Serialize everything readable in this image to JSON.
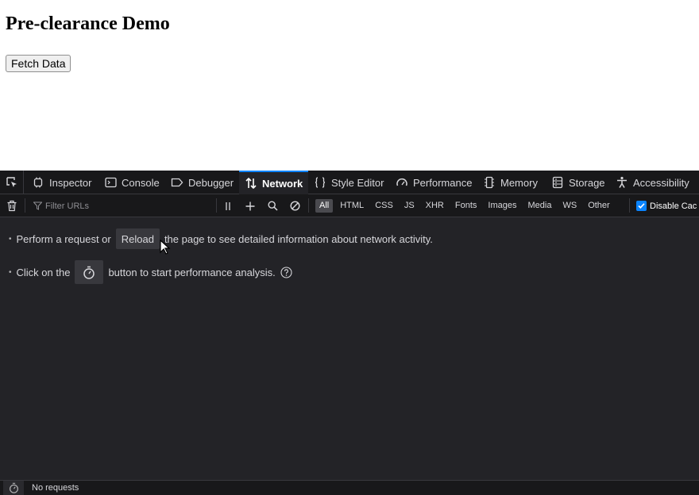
{
  "page": {
    "title": "Pre-clearance Demo",
    "fetch_button": "Fetch Data"
  },
  "devtools": {
    "tabs": [
      {
        "label": "Inspector",
        "icon": "inspector-icon"
      },
      {
        "label": "Console",
        "icon": "console-icon"
      },
      {
        "label": "Debugger",
        "icon": "debugger-icon"
      },
      {
        "label": "Network",
        "icon": "network-icon",
        "active": true
      },
      {
        "label": "Style Editor",
        "icon": "style-editor-icon"
      },
      {
        "label": "Performance",
        "icon": "performance-icon"
      },
      {
        "label": "Memory",
        "icon": "memory-icon"
      },
      {
        "label": "Storage",
        "icon": "storage-icon"
      },
      {
        "label": "Accessibility",
        "icon": "accessibility-icon"
      }
    ],
    "toolbar": {
      "filter_placeholder": "Filter URLs",
      "type_filters": [
        "All",
        "HTML",
        "CSS",
        "JS",
        "XHR",
        "Fonts",
        "Images",
        "Media",
        "WS",
        "Other"
      ],
      "active_filter": "All",
      "disable_cache_label": "Disable Cac",
      "disable_cache_checked": true
    },
    "content": {
      "line1_before": "Perform a request or",
      "reload_button": "Reload",
      "line1_after": "the page to see detailed information about network activity.",
      "line2_before": "Click on the",
      "line2_after": "button to start performance analysis."
    },
    "status": {
      "text": "No requests"
    }
  },
  "colors": {
    "devtools_bg": "#232327",
    "toolbar_bg": "#18181a",
    "accent": "#0a84ff",
    "text": "#d7d7db"
  }
}
